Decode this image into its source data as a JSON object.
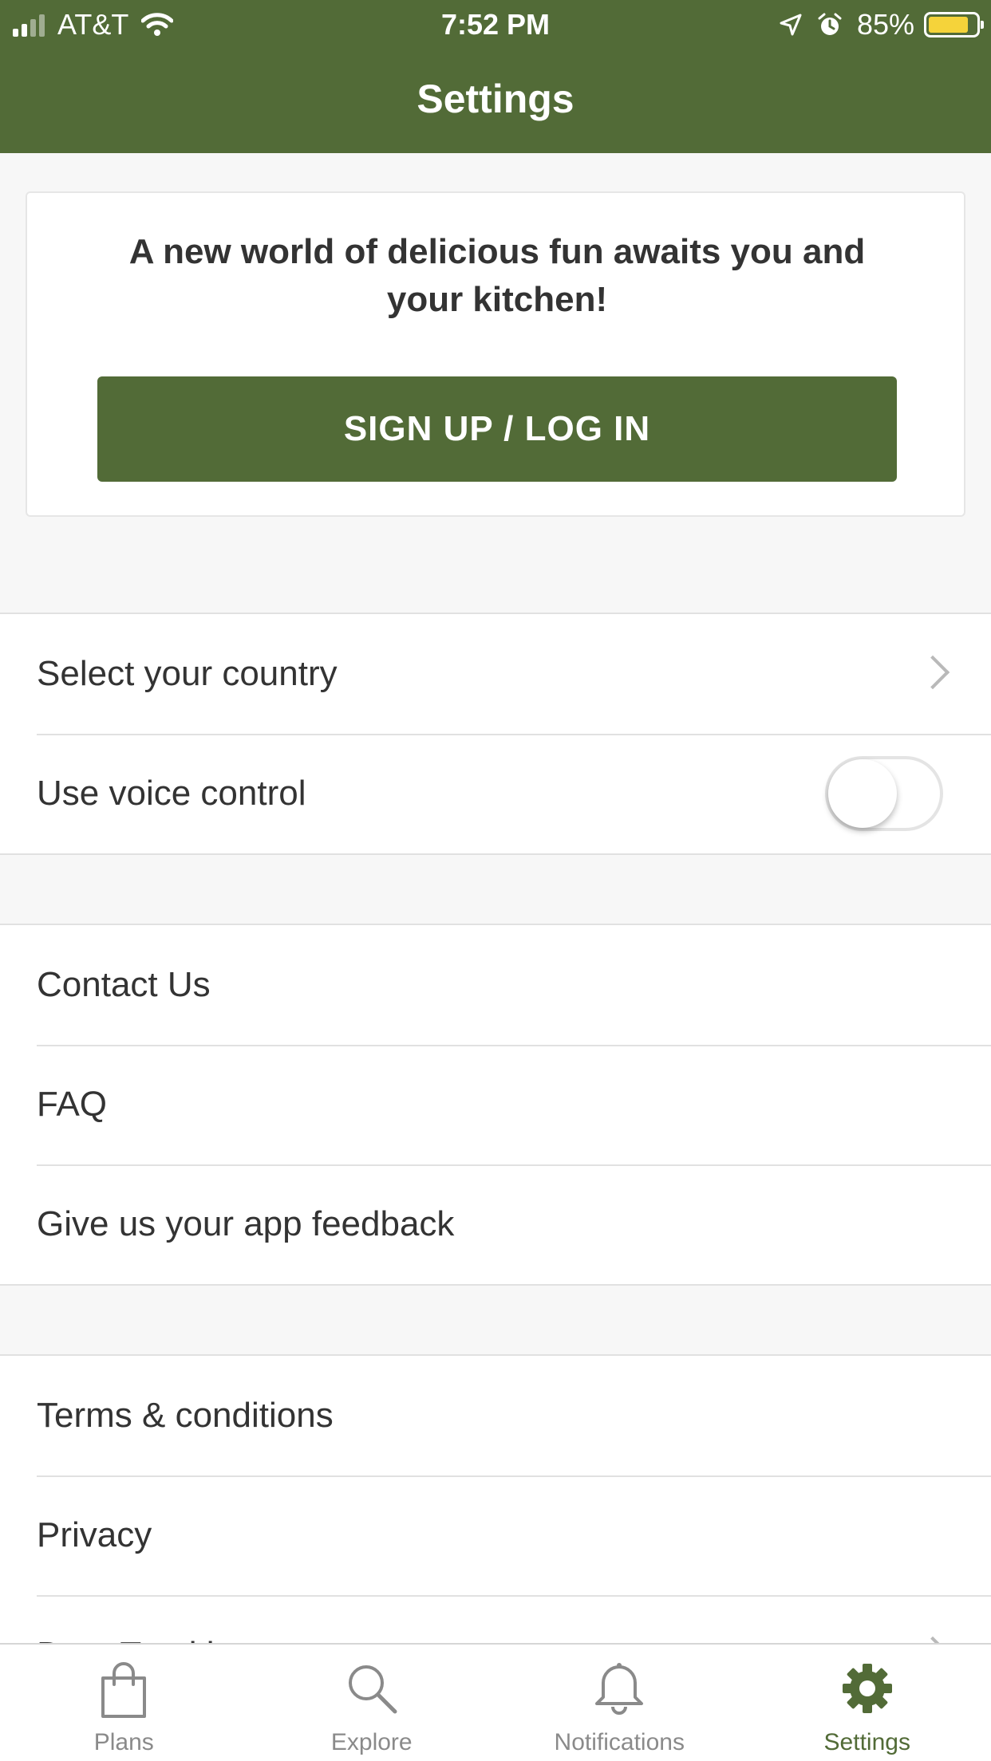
{
  "status_bar": {
    "carrier": "AT&T",
    "time": "7:52 PM",
    "battery": "85%",
    "battery_level": 0.85,
    "icons": [
      "signal-icon",
      "wifi-icon",
      "location-icon",
      "alarm-icon",
      "battery-icon"
    ]
  },
  "header": {
    "title": "Settings",
    "color": "#526b37"
  },
  "promo": {
    "text": "A new world of delicious fun awaits you and your kitchen!",
    "button_label": "SIGN UP / LOG IN"
  },
  "groups": {
    "general": [
      {
        "label": "Select your country",
        "accessory": "chevron-right-icon"
      },
      {
        "label": "Use voice control",
        "accessory": "toggle",
        "toggle_on": false
      }
    ],
    "support": [
      {
        "label": "Contact Us"
      },
      {
        "label": "FAQ"
      },
      {
        "label": "Give us your app feedback"
      }
    ],
    "legal": [
      {
        "label": "Terms & conditions"
      },
      {
        "label": "Privacy"
      },
      {
        "label": "Data Tracking",
        "accessory": "chevron-right-icon"
      }
    ]
  },
  "tabbar": {
    "tabs": [
      {
        "label": "Plans",
        "icon": "shopping-bag-icon",
        "active": false
      },
      {
        "label": "Explore",
        "icon": "search-icon",
        "active": false
      },
      {
        "label": "Notifications",
        "icon": "bell-icon",
        "active": false
      },
      {
        "label": "Settings",
        "icon": "gear-icon",
        "active": true
      }
    ],
    "active_color": "#526b37",
    "inactive_color": "#8a8a8a"
  }
}
